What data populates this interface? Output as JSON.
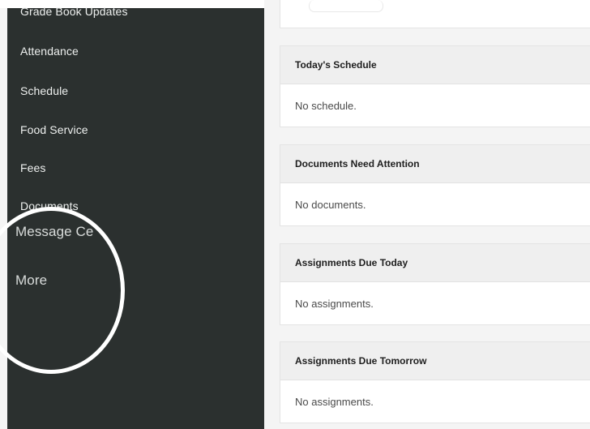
{
  "sidebar": {
    "items": [
      {
        "label": "Grade Book Updates"
      },
      {
        "label": "Attendance"
      },
      {
        "label": "Schedule"
      },
      {
        "label": "Food Service"
      },
      {
        "label": "Fees"
      },
      {
        "label": "Documents"
      },
      {
        "label": "Message Ce"
      },
      {
        "label": "More"
      }
    ]
  },
  "main": {
    "cards": [
      {
        "title": "Today's Schedule",
        "body": "No schedule."
      },
      {
        "title": "Documents Need Attention",
        "body": "No documents."
      },
      {
        "title": "Assignments Due Today",
        "body": "No assignments."
      },
      {
        "title": "Assignments Due Tomorrow",
        "body": "No assignments."
      }
    ]
  },
  "colors": {
    "sidebar_bg": "#2b302f",
    "sidebar_text": "#eef0ef",
    "content_bg": "#f4f4f4",
    "card_header_bg": "#efefef",
    "annotation_circle": "#ffffff"
  }
}
